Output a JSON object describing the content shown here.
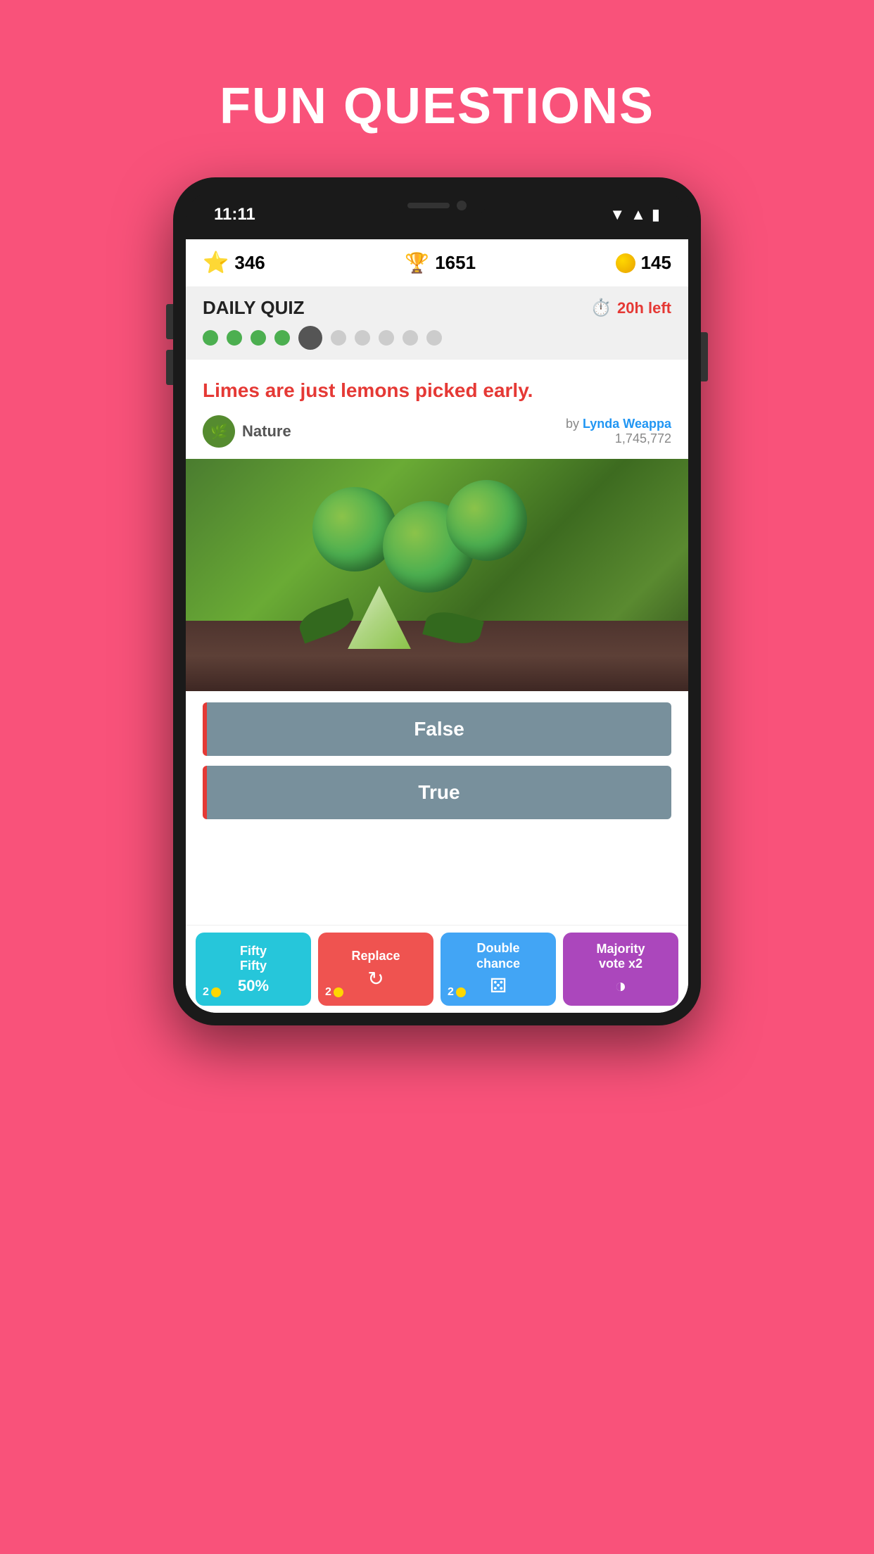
{
  "page": {
    "background_color": "#F9527A",
    "title": "FUN QUESTIONS"
  },
  "header": {
    "stars": "346",
    "trophy": "1651",
    "coins": "145"
  },
  "daily_quiz": {
    "label": "DAILY QUIZ",
    "timer": "20h left",
    "dots_completed": 4,
    "dots_total": 10
  },
  "question": {
    "text": "Limes are just lemons picked early.",
    "category": "Nature",
    "author_by": "by",
    "author_name": "Lynda Weappa",
    "author_score": "1,745,772"
  },
  "answers": [
    {
      "label": "False"
    },
    {
      "label": "True"
    }
  ],
  "powerups": [
    {
      "label": "Fifty\nFifty",
      "icon": "50%",
      "count": "2",
      "class": "powerup-fifty"
    },
    {
      "label": "Replace",
      "icon": "↻",
      "count": "2",
      "class": "powerup-replace"
    },
    {
      "label": "Double\nchance",
      "icon": "⚄",
      "count": "2",
      "class": "powerup-double"
    },
    {
      "label": "Majority\nvote x2",
      "icon": "◑",
      "count": "",
      "class": "powerup-majority"
    }
  ],
  "status_bar": {
    "time": "11:11"
  }
}
